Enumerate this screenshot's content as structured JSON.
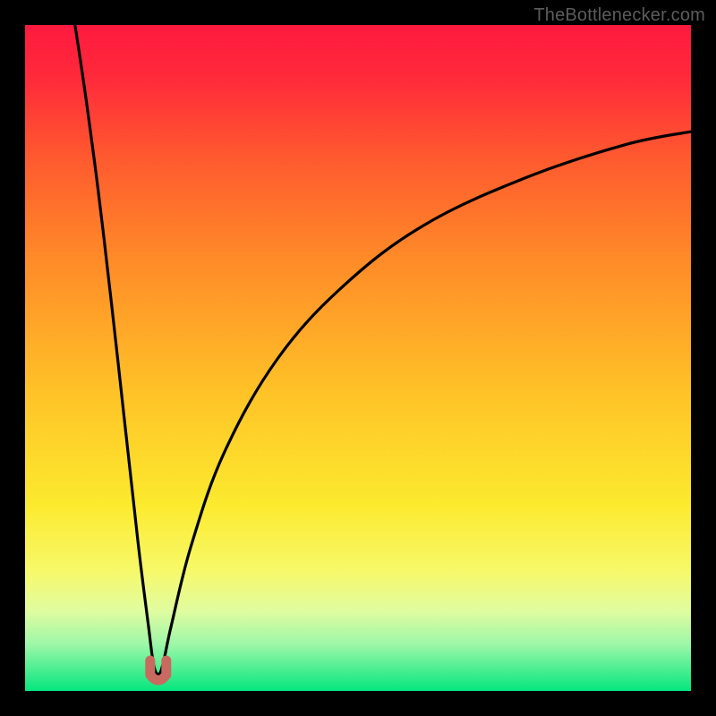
{
  "watermark": "TheBottlenecker.com",
  "chart_data": {
    "type": "line",
    "title": "",
    "xlabel": "",
    "ylabel": "",
    "xlim": [
      0,
      100
    ],
    "ylim": [
      0,
      100
    ],
    "background": {
      "gradient_stops": [
        {
          "pct": 0,
          "color": "#ff1a3f"
        },
        {
          "pct": 8,
          "color": "#ff2a3a"
        },
        {
          "pct": 20,
          "color": "#ff5a2f"
        },
        {
          "pct": 35,
          "color": "#ff8a28"
        },
        {
          "pct": 55,
          "color": "#ffc227"
        },
        {
          "pct": 72,
          "color": "#fcea2e"
        },
        {
          "pct": 82,
          "color": "#f7f96a"
        },
        {
          "pct": 88,
          "color": "#e0fca0"
        },
        {
          "pct": 93,
          "color": "#9df7a8"
        },
        {
          "pct": 100,
          "color": "#05e67e"
        }
      ]
    },
    "curve": {
      "description": "V-shaped bottleneck curve with minimum near x≈20, rising steeply to left edge and asymptotically toward ~84 on the right",
      "dip": {
        "x": 20,
        "marker_color": "#c86a5f",
        "marker_shape": "U"
      },
      "points": [
        {
          "x": 7.5,
          "y": 100
        },
        {
          "x": 9,
          "y": 90
        },
        {
          "x": 11,
          "y": 75
        },
        {
          "x": 13,
          "y": 58
        },
        {
          "x": 15,
          "y": 40
        },
        {
          "x": 17,
          "y": 22
        },
        {
          "x": 18.5,
          "y": 10
        },
        {
          "x": 19.3,
          "y": 4
        },
        {
          "x": 20,
          "y": 2.5
        },
        {
          "x": 20.7,
          "y": 4
        },
        {
          "x": 22,
          "y": 10
        },
        {
          "x": 25,
          "y": 22
        },
        {
          "x": 30,
          "y": 36
        },
        {
          "x": 38,
          "y": 50
        },
        {
          "x": 48,
          "y": 61
        },
        {
          "x": 60,
          "y": 70
        },
        {
          "x": 75,
          "y": 77
        },
        {
          "x": 90,
          "y": 82
        },
        {
          "x": 100,
          "y": 84
        }
      ]
    }
  }
}
